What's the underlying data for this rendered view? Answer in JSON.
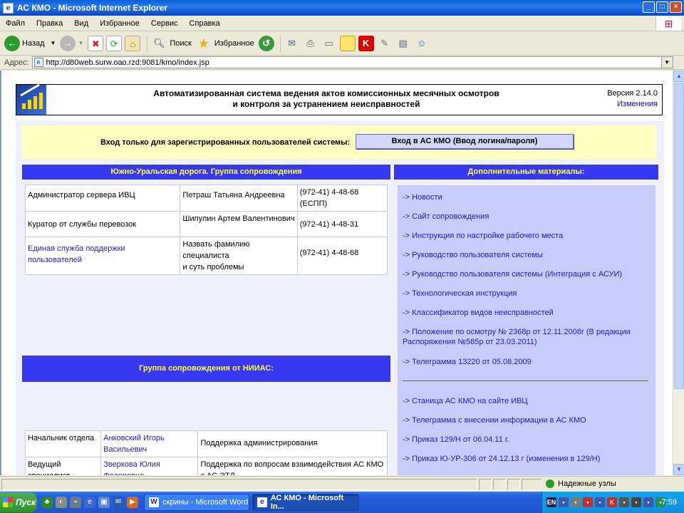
{
  "window": {
    "title": "АС КМО - Microsoft Internet Explorer",
    "min": "_",
    "max": "□",
    "close": "×"
  },
  "menu": [
    "Файл",
    "Правка",
    "Вид",
    "Избранное",
    "Сервис",
    "Справка"
  ],
  "toolbar": {
    "back_label": "Назад",
    "search_label": "Поиск",
    "favorites_label": "Избранное"
  },
  "address": {
    "label": "Адрес:",
    "url": "http://d80web.surw.oao.rzd:9081/kmo/index.jsp"
  },
  "header": {
    "title_line1": "Автоматизированная система ведения актов комиссионных месячных осмотров",
    "title_line2": "и контроля за устранением неисправностей",
    "version": "Версия 2.14.0",
    "changes_link": "Изменения"
  },
  "login": {
    "text": "Вход только для зарегистрированных пользователей системы:",
    "button": "Вход в АС КМО (Ввод логина/пароля)"
  },
  "group1": {
    "title": "Южно-Уральская дорога. Группа сопровождения",
    "rows": [
      {
        "role": "Администратор сервера ИВЦ",
        "person": "Петраш Татьяна Андреевна",
        "phone": "(972-41) 4-48-68 (ЕСПП)"
      },
      {
        "role": "Куратор от службы перевозок",
        "person": "Шипулин Артем Валентинович",
        "phone": "(972-41) 4-48-31"
      },
      {
        "role": "Единая служба поддержки пользователей",
        "person": "Назвать фамилию специалиста\nи суть проблемы",
        "phone": "(972-41) 4-48-68"
      }
    ]
  },
  "extra": {
    "title": "Дополнительные материалы:",
    "links": [
      "-> Новости",
      "-> Сайт сопровождения",
      "-> Инструкция по настройке рабочего места",
      "-> Руководство пользователя системы",
      "-> Руководство пользователя системы (Интеграция с АСУИ)",
      "-> Технологическая инструкция",
      "-> Классификатор видов неисправностей",
      "-> Положение по осмотру № 2368р от 12.11.2008г (В редакции Распоряжения №585р от 23.03.2011)",
      "-> Телеграмма 13220 от 05.08.2009"
    ],
    "links2": [
      "-> Станица АС КМО на сайте ИВЦ",
      "-> Телеграмма с внесении информации в АС КМО",
      "-> Приказ 129/Н от 06.04.11 г.",
      "-> Приказ Ю-УР-306 от 24.12.13 г (изменения в 129/Н)"
    ]
  },
  "group2": {
    "title": "Группа сопровождения от НИИАС:",
    "rows": [
      {
        "role": "Начальник отдела",
        "person": "Анковский Игорь Васильевич",
        "task": "Поддержка администрирования"
      },
      {
        "role": "Ведущий специалист",
        "person": "Зверкова Юлия Федоровна",
        "task": "Поддержка по вопросам взаимодействия АС КМО с АС ЭТД"
      }
    ]
  },
  "status": {
    "zone": "Надежные узлы"
  },
  "taskbar": {
    "start": "Пуск",
    "task1": "скрины - Microsoft Word",
    "task2": "АС КМО - Microsoft In...",
    "clock": "7:59",
    "lang": "EN"
  }
}
